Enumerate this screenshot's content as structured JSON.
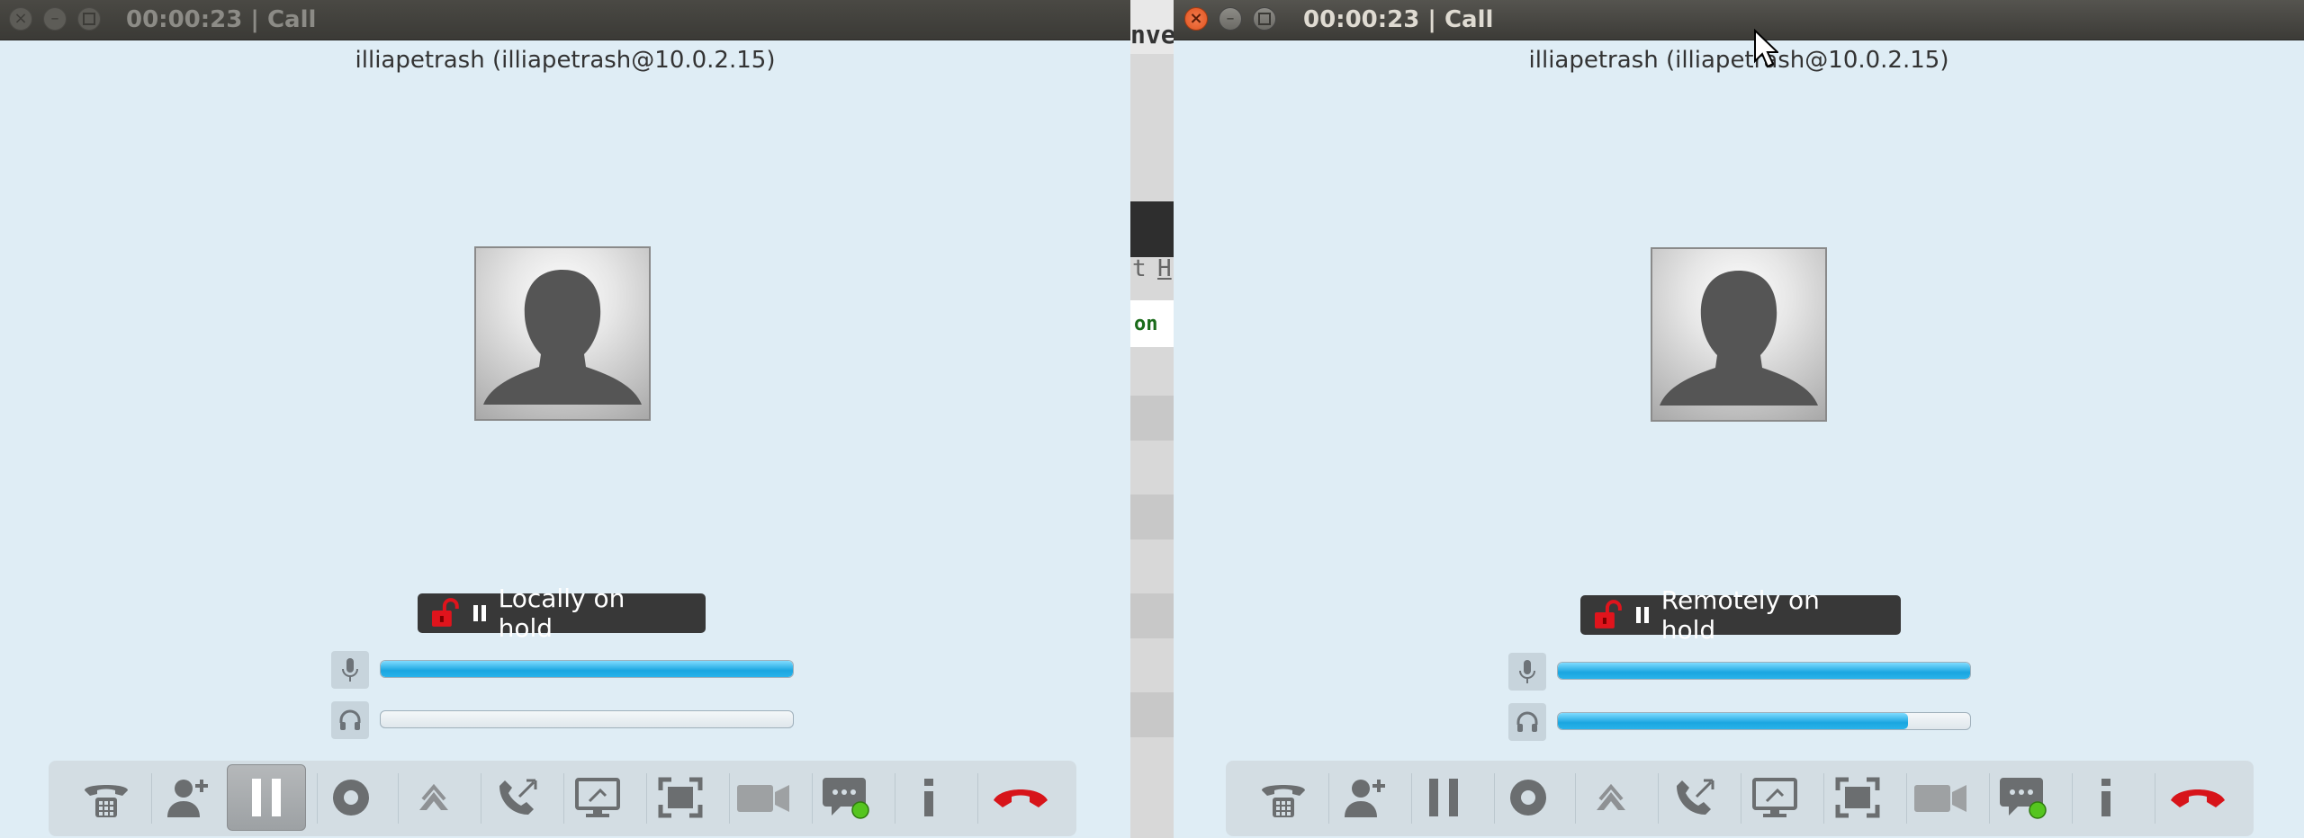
{
  "windows": [
    {
      "id": "left",
      "title": "00:00:23 | Call",
      "focused": false,
      "peer": "illiapetrash (illiapetrash@10.0.2.15)",
      "hold_status": "Locally on hold",
      "mic_level": 1.0,
      "speaker_level": 0.0,
      "pressed_tool": "hold"
    },
    {
      "id": "right",
      "title": "00:00:23 | Call",
      "focused": true,
      "peer": "illiapetrash (illiapetrash@10.0.2.15)",
      "hold_status": "Remotely on hold",
      "mic_level": 1.0,
      "speaker_level": 0.85,
      "pressed_tool": null
    }
  ],
  "background_app": {
    "fragments": [
      "nve",
      "t",
      "H",
      "on"
    ]
  },
  "toolbar_icons": [
    "dialpad-icon",
    "add-contact-icon",
    "hold-icon",
    "record-icon",
    "transfer-icon",
    "call-transfer-icon",
    "screen-share-icon",
    "fullscreen-icon",
    "video-icon",
    "chat-icon",
    "info-icon",
    "hangup-icon"
  ],
  "colors": {
    "window_bg": "#dfedf5",
    "titlebar": "#3c3b37",
    "level_fill": "#1aa6e0",
    "hangup": "#d7141a",
    "lock": "#e0141c"
  }
}
